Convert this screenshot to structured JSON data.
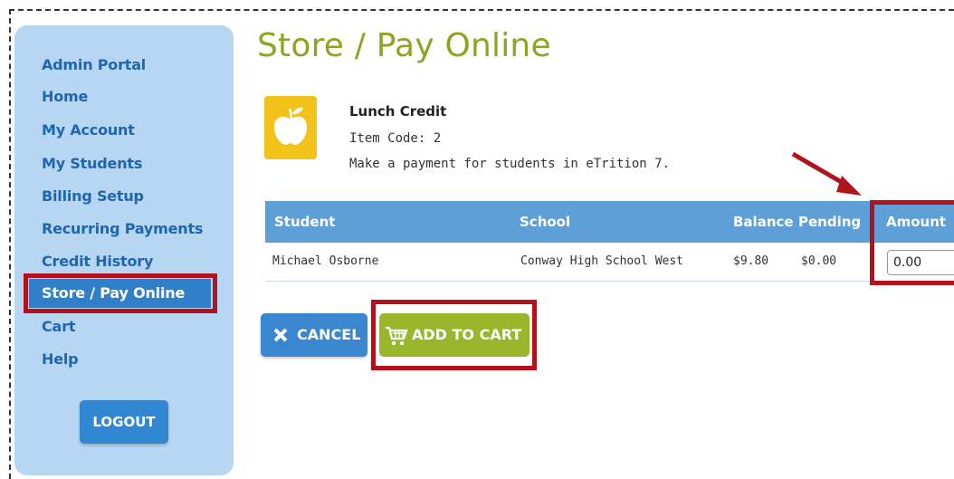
{
  "sidebar": {
    "items": [
      {
        "label": "Admin Portal"
      },
      {
        "label": "Home"
      },
      {
        "label": "My Account"
      },
      {
        "label": "My Students"
      },
      {
        "label": "Billing Setup"
      },
      {
        "label": "Recurring Payments"
      },
      {
        "label": "Credit History"
      },
      {
        "label": "Store / Pay Online",
        "active": true
      },
      {
        "label": "Cart"
      },
      {
        "label": "Help"
      }
    ],
    "logout_label": "LOGOUT"
  },
  "page": {
    "title": "Store / Pay Online"
  },
  "product": {
    "icon": "apple-icon",
    "name": "Lunch Credit",
    "item_code": "Item Code: 2",
    "description": "Make a payment for students in eTrition 7."
  },
  "table": {
    "headers": [
      "Student",
      "School",
      "Balance",
      "Pending",
      "Amount"
    ],
    "rows": [
      {
        "student": "Michael Osborne",
        "school": "Conway High School West",
        "balance": "$9.80",
        "pending": "$0.00",
        "amount": "0.00"
      }
    ]
  },
  "buttons": {
    "cancel": "CANCEL",
    "add_to_cart": "ADD TO CART"
  },
  "colors": {
    "accent_green": "#8ba524",
    "header_blue": "#5d9fd6",
    "highlight_red": "#b2121d",
    "sidebar_bg": "#b7d6f1"
  }
}
